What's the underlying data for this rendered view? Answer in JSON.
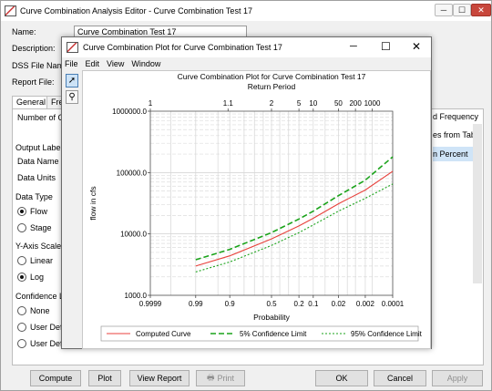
{
  "back_window": {
    "title": "Curve Combination Analysis Editor - Curve Combination Test 17",
    "controls": {
      "minimize": "─",
      "maximize": "☐",
      "close": "✕"
    },
    "name_label": "Name:",
    "name_value": "Curve Combination Test 17",
    "description_label": "Description:",
    "dss_label": "DSS File Nam",
    "report_label": "Report File:",
    "tabs": [
      "General",
      "Fre"
    ],
    "number_label": "Number of C",
    "right_texts": [
      "d Frequency",
      "es from Tabl",
      "n Percent"
    ],
    "output_labels_heading": "Output Labels",
    "data_name_label": "Data Name",
    "data_units_label": "Data Units",
    "data_type_heading": "Data Type",
    "data_type_options": [
      "Flow",
      "Stage"
    ],
    "data_type_selected": "Flow",
    "y_axis_heading": "Y-Axis Scale",
    "y_axis_options": [
      "Linear",
      "Log"
    ],
    "y_axis_selected": "Log",
    "confidence_heading": "Confidence L",
    "confidence_options": [
      "None",
      "User Defi",
      "User Defi"
    ],
    "buttons": {
      "compute": "Compute",
      "plot": "Plot",
      "view_report": "View Report",
      "print": "Print",
      "ok": "OK",
      "cancel": "Cancel",
      "apply": "Apply"
    }
  },
  "front_window": {
    "title": "Curve Combination Plot for Curve Combination Test 17",
    "controls": {
      "minimize": "─",
      "maximize": "☐",
      "close": "✕"
    },
    "menu": [
      "File",
      "Edit",
      "View",
      "Window"
    ],
    "tools": {
      "pointer": "pointer-icon",
      "zoom": "zoom-icon"
    }
  },
  "chart_data": {
    "type": "line",
    "title": "Curve Combination Plot for Curve Combination Test 17",
    "top_axis_label": "Return Period",
    "top_ticks": [
      "1",
      "1.1",
      "2",
      "5",
      "10",
      "50",
      "200",
      "1000"
    ],
    "xlabel": "Probability",
    "x_ticks": [
      "0.9999",
      "0.99",
      "0.9",
      "0.5",
      "0.2",
      "0.1",
      "0.02",
      "0.002",
      "0.0001"
    ],
    "ylabel": "flow in cfs",
    "y_scale": "log",
    "y_ticks": [
      "1000.0",
      "10000.0",
      "100000.0",
      "1000000.0"
    ],
    "ylim": [
      1000,
      1000000
    ],
    "grid": true,
    "legend_position": "bottom",
    "x": [
      0.99,
      0.9,
      0.5,
      0.2,
      0.1,
      0.02,
      0.002,
      0.0001
    ],
    "series": [
      {
        "name": "Computed Curve",
        "style": "solid",
        "color": "#e8413c",
        "values": [
          3000,
          4400,
          8300,
          13500,
          18000,
          31000,
          52000,
          105000
        ]
      },
      {
        "name": "5% Confidence Limit",
        "style": "dashed",
        "color": "#1aa31a",
        "values": [
          3800,
          5600,
          10500,
          17500,
          23500,
          42000,
          75000,
          180000
        ]
      },
      {
        "name": "95% Confidence Limit",
        "style": "dotted",
        "color": "#1aa31a",
        "values": [
          2400,
          3500,
          6500,
          10500,
          14000,
          23500,
          38000,
          65000
        ]
      }
    ]
  }
}
